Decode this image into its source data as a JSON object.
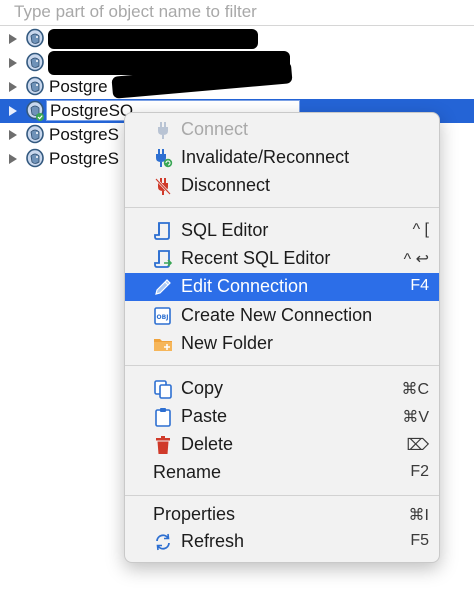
{
  "filter": {
    "placeholder": "Type part of object name to filter",
    "value": ""
  },
  "tree": {
    "rows": [
      {
        "label": ""
      },
      {
        "label": ""
      },
      {
        "label": "Postgre"
      },
      {
        "label": "PostgreSQ"
      },
      {
        "label": "PostgreS"
      },
      {
        "label": "PostgreS"
      }
    ]
  },
  "menu": {
    "connect": {
      "label": "Connect",
      "icon": "plug-icon"
    },
    "invalidate": {
      "label": "Invalidate/Reconnect",
      "icon": "plug-refresh-icon"
    },
    "disconnect": {
      "label": "Disconnect",
      "icon": "plug-disconnect-icon"
    },
    "sql_editor": {
      "label": "SQL Editor",
      "shortcut": "^ [",
      "icon": "sql-editor-icon"
    },
    "recent_sql_editor": {
      "label": "Recent SQL Editor",
      "shortcut": "^ ↩",
      "icon": "recent-sql-editor-icon"
    },
    "edit_connection": {
      "label": "Edit Connection",
      "shortcut": "F4",
      "icon": "pencil-icon"
    },
    "create_connection": {
      "label": "Create New Connection",
      "icon": "new-connection-icon"
    },
    "new_folder": {
      "label": "New Folder",
      "icon": "folder-icon"
    },
    "copy": {
      "label": "Copy",
      "shortcut": "⌘C",
      "icon": "copy-icon"
    },
    "paste": {
      "label": "Paste",
      "shortcut": "⌘V",
      "icon": "paste-icon"
    },
    "delete": {
      "label": "Delete",
      "shortcut": "⌦",
      "icon": "trash-icon"
    },
    "rename": {
      "label": "Rename",
      "shortcut": "F2"
    },
    "properties": {
      "label": "Properties",
      "shortcut": "⌘I"
    },
    "refresh": {
      "label": "Refresh",
      "shortcut": "F5",
      "icon": "refresh-icon"
    }
  },
  "colors": {
    "selection": "#2464d6",
    "highlight": "#2c6ee8",
    "menu_bg": "#f2f2f2",
    "icon_blue": "#2d6fd1",
    "icon_red": "#d03a2a",
    "icon_green": "#3aa655",
    "folder_orange": "#f0a23a"
  }
}
